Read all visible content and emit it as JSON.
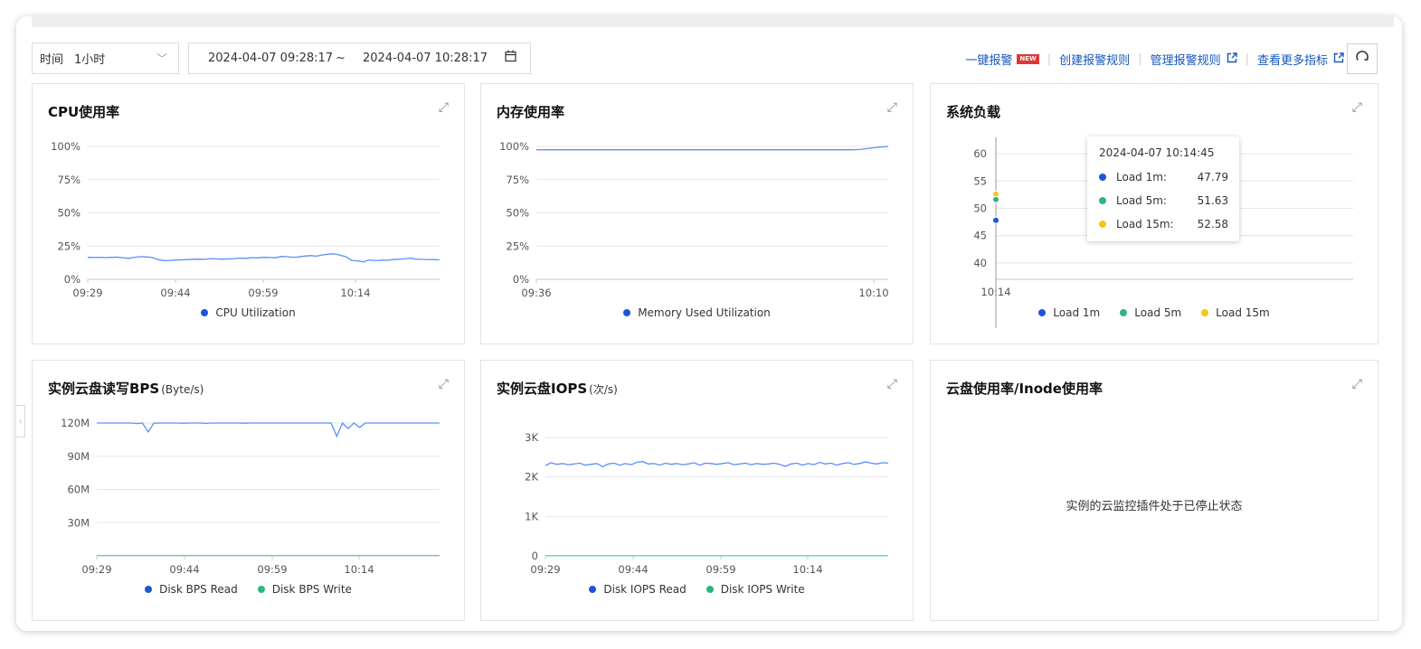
{
  "toolbar": {
    "time_label": "时间",
    "time_value": "1小时",
    "range_start": "2024-04-07 09:28:17",
    "range_sep": "~",
    "range_end": "2024-04-07 10:28:17",
    "actions": {
      "quick_alarm": "一键报警",
      "new_badge": "NEW",
      "create_rule": "创建报警规则",
      "manage_rule": "管理报警规则",
      "more_metrics": "查看更多指标"
    }
  },
  "icons": {
    "chevron": "chevron-down-icon",
    "calendar": "calendar-icon",
    "external": "external-link-icon",
    "refresh": "refresh-icon",
    "expand": "expand-icon"
  },
  "colors": {
    "blue": "#1a56db",
    "green": "#2eb67d",
    "yellow": "#f5c518",
    "line_blue": "#5b8ff9",
    "line_green": "#5ad8a6",
    "link": "#1557c0"
  },
  "panels": {
    "cpu": {
      "title": "CPU使用率",
      "legend": [
        "CPU Utilization"
      ]
    },
    "mem": {
      "title": "内存使用率",
      "legend": [
        "Memory Used Utilization"
      ]
    },
    "load": {
      "title": "系统负载",
      "legend": [
        "Load 1m",
        "Load 5m",
        "Load 15m"
      ],
      "tooltip": {
        "time": "2024-04-07 10:14:45",
        "rows": [
          {
            "label": "Load 1m:",
            "value": "47.79"
          },
          {
            "label": "Load 5m:",
            "value": "51.63"
          },
          {
            "label": "Load 15m:",
            "value": "52.58"
          }
        ]
      }
    },
    "bps": {
      "title": "实例云盘读写BPS",
      "unit": "(Byte/s)",
      "legend": [
        "Disk BPS Read",
        "Disk BPS Write"
      ]
    },
    "iops": {
      "title": "实例云盘IOPS",
      "unit": "(次/s)",
      "legend": [
        "Disk IOPS Read",
        "Disk IOPS Write"
      ]
    },
    "inode": {
      "title": "云盘使用率/Inode使用率",
      "message": "实例的云监控插件处于已停止状态"
    }
  },
  "chart_data": [
    {
      "id": "cpu",
      "type": "line",
      "ylim": [
        0,
        100
      ],
      "yticks": [
        "0%",
        "25%",
        "50%",
        "75%",
        "100%"
      ],
      "xticks": [
        "09:29",
        "09:44",
        "09:59",
        "10:14"
      ],
      "x_range_minutes": [
        0,
        60
      ],
      "series": [
        {
          "name": "CPU Utilization",
          "values": [
            16.5,
            16.4,
            16.6,
            16.3,
            16.5,
            16.7,
            16.2,
            15.8,
            16.6,
            17.1,
            16.9,
            16.4,
            14.8,
            14.1,
            14.2,
            14.5,
            14.6,
            14.8,
            15.1,
            15.2,
            15.0,
            15.6,
            15.3,
            15.1,
            15.4,
            15.6,
            16.0,
            15.8,
            16.3,
            16.1,
            16.5,
            16.4,
            16.2,
            17.2,
            17.0,
            16.6,
            16.9,
            17.5,
            17.8,
            17.4,
            18.3,
            18.9,
            19.2,
            18.2,
            17.0,
            14.2,
            13.9,
            13.1,
            14.6,
            14.0,
            14.4,
            14.3,
            14.8,
            15.1,
            15.4,
            15.9,
            15.2,
            15.0,
            14.9,
            14.8,
            14.6
          ]
        }
      ]
    },
    {
      "id": "mem",
      "type": "line",
      "ylim": [
        0,
        100
      ],
      "yticks": [
        "0%",
        "25%",
        "50%",
        "75%",
        "100%"
      ],
      "xticks": [
        "09:36",
        "10:10"
      ],
      "x_range_minutes": [
        0,
        36
      ],
      "series": [
        {
          "name": "Memory Used Utilization",
          "values": [
            97.5,
            97.5,
            97.5,
            97.5,
            97.5,
            97.5,
            97.5,
            97.5,
            97.5,
            97.5,
            97.5,
            97.5,
            97.5,
            97.5,
            97.5,
            97.5,
            97.5,
            97.5,
            97.5,
            97.5,
            97.5,
            97.5,
            97.5,
            97.5,
            97.5,
            97.5,
            97.5,
            97.5,
            97.5,
            97.5,
            97.5,
            97.5,
            97.5,
            97.6,
            98.6,
            99.4,
            100
          ]
        }
      ]
    },
    {
      "id": "load",
      "type": "scatter",
      "ylim": [
        37,
        63
      ],
      "yticks": [
        "40",
        "45",
        "50",
        "55",
        "60"
      ],
      "xticks": [
        "10:14"
      ],
      "series": [
        {
          "name": "Load 1m",
          "values": [
            47.79
          ]
        },
        {
          "name": "Load 5m",
          "values": [
            51.63
          ]
        },
        {
          "name": "Load 15m",
          "values": [
            52.58
          ]
        }
      ]
    },
    {
      "id": "bps",
      "type": "line",
      "ylim": [
        0,
        120
      ],
      "yticks": [
        "30M",
        "60M",
        "90M",
        "120M"
      ],
      "xticks": [
        "09:29",
        "09:44",
        "09:59",
        "10:14"
      ],
      "x_range_minutes": [
        0,
        60
      ],
      "series": [
        {
          "name": "Disk BPS Read",
          "values": [
            120,
            120,
            120,
            120,
            120,
            120,
            120,
            119.5,
            120,
            112,
            119.8,
            120,
            120,
            120,
            120,
            119.8,
            120,
            120,
            120,
            119.7,
            120,
            120,
            120,
            120,
            120,
            120,
            119.8,
            120,
            120,
            120,
            120,
            120,
            120,
            120,
            120,
            120,
            120,
            120,
            120,
            120,
            120,
            120,
            108,
            120,
            115,
            120,
            116,
            120,
            120,
            120,
            120,
            120,
            120,
            120,
            120,
            120,
            120,
            120,
            120,
            120,
            120
          ]
        },
        {
          "name": "Disk BPS Write",
          "values": [
            0.4,
            0.4,
            0.4,
            0.4,
            0.4,
            0.4,
            0.4,
            0.4,
            0.4,
            0.4,
            0.4,
            0.4,
            0.4,
            0.4,
            0.4,
            0.4,
            0.4,
            0.4,
            0.4,
            0.4,
            0.4,
            0.4,
            0.4,
            0.4,
            0.4,
            0.4,
            0.4,
            0.4,
            0.4,
            0.4,
            0.4,
            0.4,
            0.4,
            0.4,
            0.4,
            0.4,
            0.4,
            0.4,
            0.4,
            0.4,
            0.4,
            0.4,
            0.4,
            0.4,
            0.4,
            0.4,
            0.4,
            0.4,
            0.4,
            0.4,
            0.4,
            0.4,
            0.4,
            0.4,
            0.4,
            0.4,
            0.4,
            0.4,
            0.4,
            0.4,
            0.4
          ]
        }
      ]
    },
    {
      "id": "iops",
      "type": "line",
      "ylim": [
        0,
        3000
      ],
      "yticks": [
        "0",
        "1K",
        "2K",
        "3K"
      ],
      "xticks": [
        "09:29",
        "09:44",
        "09:59",
        "10:14"
      ],
      "x_range_minutes": [
        0,
        60
      ],
      "series": [
        {
          "name": "Disk IOPS Read",
          "values": [
            2290,
            2360,
            2320,
            2340,
            2310,
            2330,
            2350,
            2300,
            2320,
            2340,
            2260,
            2330,
            2350,
            2300,
            2340,
            2310,
            2370,
            2390,
            2330,
            2340,
            2300,
            2350,
            2320,
            2340,
            2310,
            2330,
            2360,
            2300,
            2350,
            2340,
            2320,
            2340,
            2360,
            2310,
            2330,
            2350,
            2310,
            2340,
            2320,
            2330,
            2350,
            2320,
            2270,
            2330,
            2350,
            2300,
            2340,
            2310,
            2370,
            2330,
            2350,
            2300,
            2340,
            2360,
            2320,
            2340,
            2380,
            2350,
            2330,
            2360,
            2350
          ]
        },
        {
          "name": "Disk IOPS Write",
          "values": [
            5,
            5,
            5,
            5,
            5,
            5,
            5,
            5,
            5,
            5,
            5,
            5,
            5,
            5,
            5,
            5,
            5,
            5,
            5,
            5,
            5,
            5,
            5,
            5,
            5,
            5,
            5,
            5,
            5,
            5,
            5,
            5,
            5,
            5,
            5,
            5,
            5,
            5,
            5,
            5,
            5,
            5,
            5,
            5,
            5,
            5,
            5,
            5,
            5,
            5,
            5,
            5,
            5,
            5,
            5,
            5,
            5,
            5,
            5,
            5,
            5
          ]
        }
      ]
    }
  ]
}
